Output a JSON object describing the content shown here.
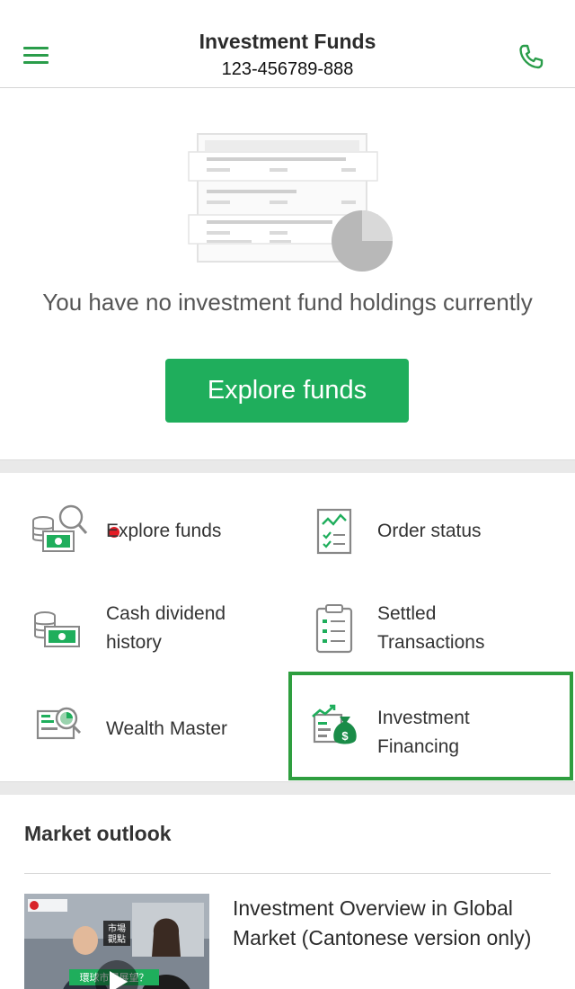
{
  "header": {
    "title": "Investment Funds",
    "account_number": "123-456789-888",
    "menu_icon": "hamburger-menu-icon",
    "phone_icon": "phone-icon"
  },
  "empty_state": {
    "message": "You have no investment fund holdings currently",
    "button_label": "Explore funds"
  },
  "quick_links": [
    {
      "label": "Explore funds",
      "icon": "explore-funds-icon",
      "has_notification_dot": true
    },
    {
      "label": "Order status",
      "icon": "order-status-icon"
    },
    {
      "label_line1": "Cash dividend",
      "label_line2": "history",
      "icon": "cash-dividend-icon"
    },
    {
      "label_line1": "Settled",
      "label_line2": "Transactions",
      "icon": "clipboard-icon"
    },
    {
      "label": "Wealth Master",
      "icon": "wealth-master-icon"
    },
    {
      "label_line1": "Investment",
      "label_line2": "Financing",
      "icon": "money-bag-icon",
      "highlighted": true
    }
  ],
  "market_outlook": {
    "title": "Market outlook",
    "articles": [
      {
        "title": "Investment Overview in Global Market (Cantonese version only)",
        "thumb_badge": "市場觀點",
        "thumb_caption": "環球市場展望？"
      }
    ]
  },
  "colors": {
    "brand_green": "#1fae5c",
    "highlight_border": "#2e9e3f",
    "notification_red": "#e51b24"
  }
}
